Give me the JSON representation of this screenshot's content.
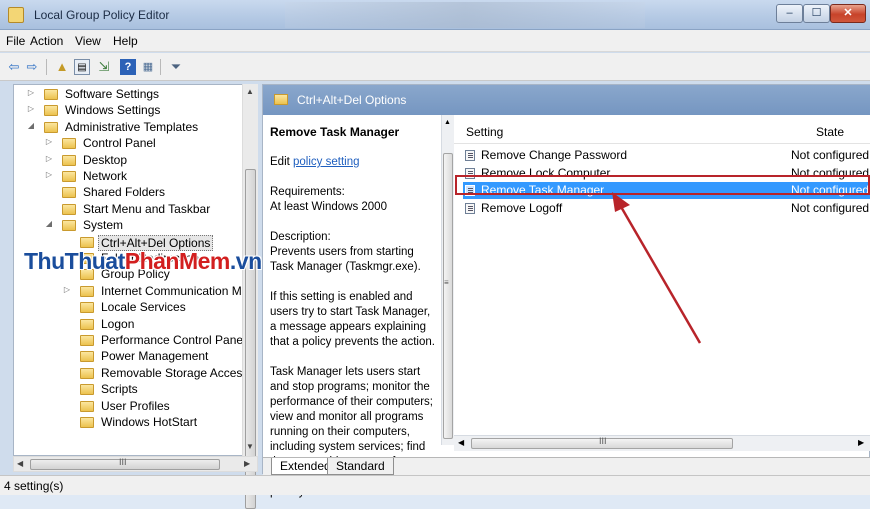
{
  "window": {
    "title": "Local Group Policy Editor"
  },
  "menubar": {
    "items": [
      "File",
      "Action",
      "View",
      "Help"
    ]
  },
  "watermark": {
    "part1": "ThuThuat",
    "part2": "PhanMem",
    "part3": ".vn"
  },
  "tree": {
    "items": [
      {
        "label": "Software Settings",
        "indent": 1,
        "expander": "collapsed"
      },
      {
        "label": "Windows Settings",
        "indent": 1,
        "expander": "collapsed"
      },
      {
        "label": "Administrative Templates",
        "indent": 1,
        "expander": "expanded"
      },
      {
        "label": "Control Panel",
        "indent": 2,
        "expander": "collapsed"
      },
      {
        "label": "Desktop",
        "indent": 2,
        "expander": "collapsed"
      },
      {
        "label": "Network",
        "indent": 2,
        "expander": "collapsed"
      },
      {
        "label": "Shared Folders",
        "indent": 2,
        "expander": "none"
      },
      {
        "label": "Start Menu and Taskbar",
        "indent": 2,
        "expander": "none"
      },
      {
        "label": "System",
        "indent": 2,
        "expander": "expanded"
      },
      {
        "label": "Ctrl+Alt+Del Options",
        "indent": 3,
        "expander": "none",
        "selected": true
      },
      {
        "label": "Folder Redirection",
        "indent": 3,
        "expander": "none"
      },
      {
        "label": "Group Policy",
        "indent": 3,
        "expander": "none"
      },
      {
        "label": "Internet Communication M",
        "indent": 3,
        "expander": "collapsed"
      },
      {
        "label": "Locale Services",
        "indent": 3,
        "expander": "none"
      },
      {
        "label": "Logon",
        "indent": 3,
        "expander": "none"
      },
      {
        "label": "Performance Control Panel",
        "indent": 3,
        "expander": "none"
      },
      {
        "label": "Power Management",
        "indent": 3,
        "expander": "none"
      },
      {
        "label": "Removable Storage Access",
        "indent": 3,
        "expander": "none"
      },
      {
        "label": "Scripts",
        "indent": 3,
        "expander": "none"
      },
      {
        "label": "User Profiles",
        "indent": 3,
        "expander": "none"
      },
      {
        "label": "Windows HotStart",
        "indent": 3,
        "expander": "none"
      }
    ]
  },
  "details": {
    "header": "Ctrl+Alt+Del Options",
    "policy_title": "Remove Task Manager",
    "edit_prefix": "Edit ",
    "edit_link": "policy setting",
    "requirements_label": "Requirements:",
    "requirements_value": "At least Windows 2000",
    "description_label": "Description:",
    "description_text": "Prevents users from starting Task Manager (Taskmgr.exe).",
    "paragraph2": "If this setting is enabled and users try to start Task Manager, a message appears explaining that a policy prevents the action.",
    "paragraph3": "Task Manager lets users start and stop programs; monitor the performance of their computers; view and monitor all programs running on their computers, including system services; find the executable names of programs; and change the priority of the"
  },
  "list": {
    "col_setting": "Setting",
    "col_state": "State",
    "rows": [
      {
        "name": "Remove Change Password",
        "state": "Not configured"
      },
      {
        "name": "Remove Lock Computer",
        "state": "Not configured"
      },
      {
        "name": "Remove Task Manager",
        "state": "Not configured",
        "selected": true
      },
      {
        "name": "Remove Logoff",
        "state": "Not configured"
      }
    ],
    "hscroll_grip": "III"
  },
  "tree_hscroll_grip": "III",
  "tabs": {
    "extended": "Extended",
    "standard": "Standard"
  },
  "status": "4 setting(s)",
  "colors": {
    "selection": "#3399ff",
    "header": "#7b9bc6",
    "highlight": "#b8242a"
  }
}
